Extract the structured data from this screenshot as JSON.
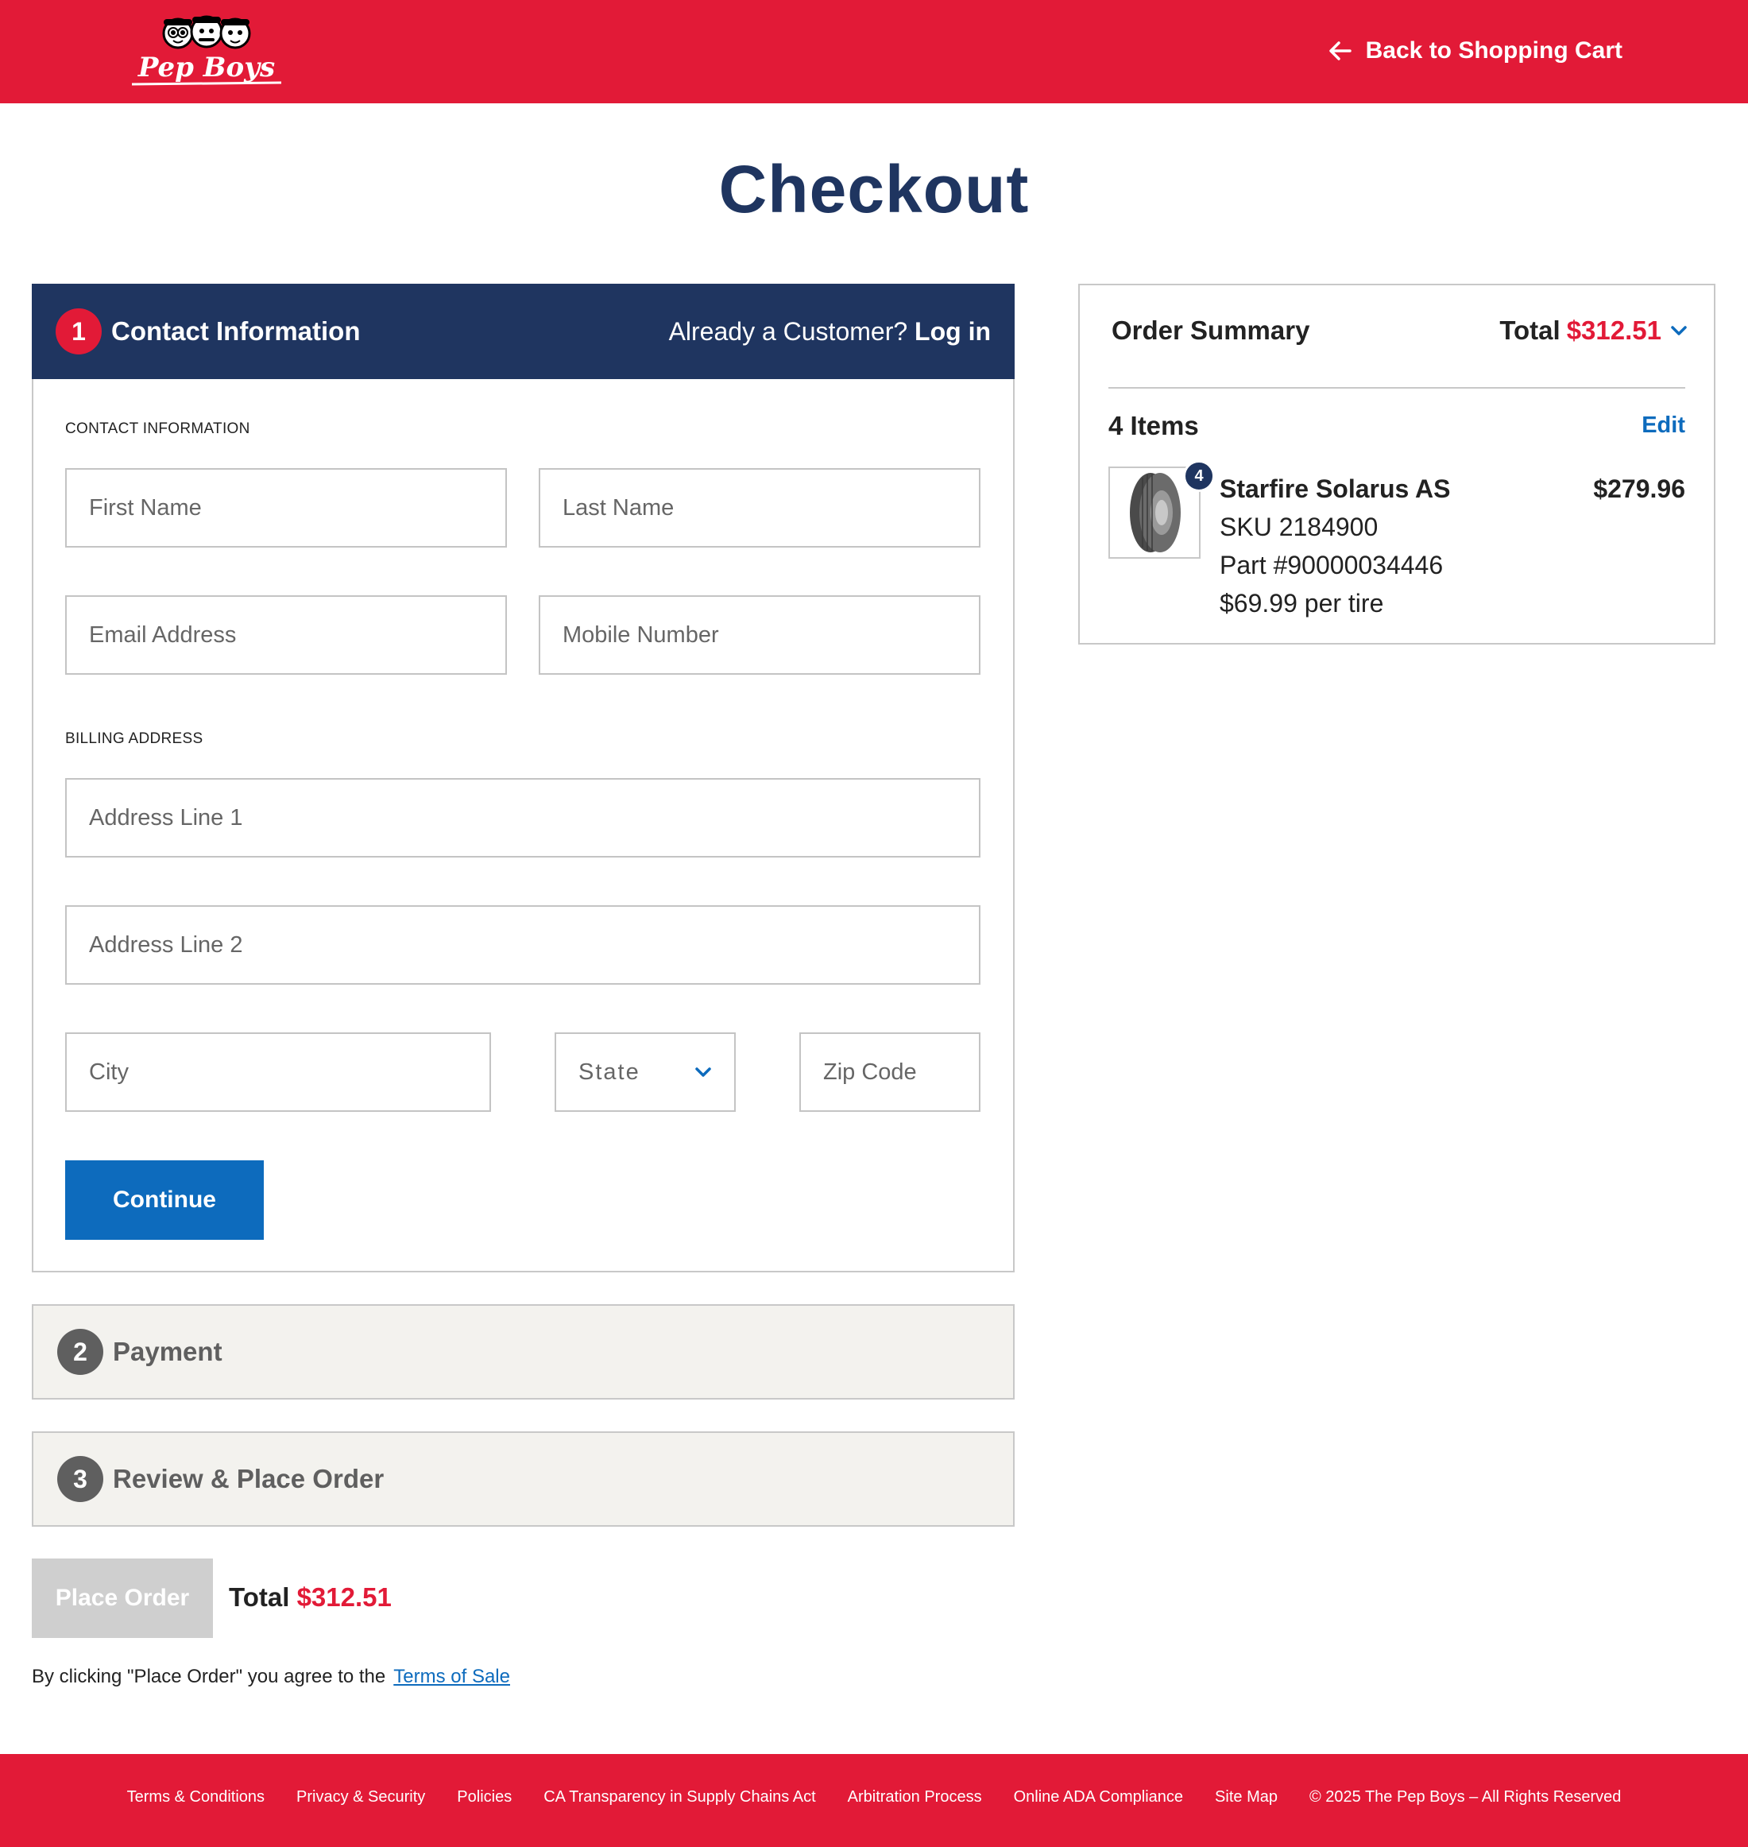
{
  "header": {
    "logo_text": "Pep Boys",
    "back_link": "Back to Shopping Cart"
  },
  "page_title": "Checkout",
  "contact_panel": {
    "step_number": "1",
    "title": "Contact Information",
    "already_customer": "Already a Customer?",
    "login_label": "Log in",
    "contact_section_label": "CONTACT INFORMATION",
    "billing_section_label": "BILLING ADDRESS",
    "fields": {
      "first_name": "First Name",
      "last_name": "Last Name",
      "email": "Email Address",
      "mobile": "Mobile Number",
      "address1": "Address Line 1",
      "address2": "Address Line 2",
      "city": "City",
      "state": "State",
      "zip": "Zip Code"
    },
    "continue_label": "Continue"
  },
  "payment_panel": {
    "step_number": "2",
    "title": "Payment"
  },
  "review_panel": {
    "step_number": "3",
    "title": "Review & Place Order"
  },
  "place_order": {
    "button_label": "Place Order",
    "total_label": "Total",
    "total_value": "$312.51",
    "terms_text": "By clicking \"Place Order\" you agree to the",
    "terms_link": "Terms of Sale"
  },
  "order_summary": {
    "title": "Order Summary",
    "total_label": "Total",
    "total_value": "$312.51",
    "items_count": "4 Items",
    "edit_label": "Edit",
    "item": {
      "quantity": "4",
      "name": "Starfire Solarus AS",
      "sku": "SKU 2184900",
      "part": "Part #90000034446",
      "unit_price": "$69.99 per tire",
      "price": "$279.96"
    }
  },
  "footer": {
    "links": [
      "Terms & Conditions",
      "Privacy & Security",
      "Policies",
      "CA Transparency in Supply Chains Act",
      "Arbitration Process",
      "Online ADA Compliance",
      "Site Map"
    ],
    "copyright": "© 2025 The Pep Boys – All Rights Reserved"
  },
  "colors": {
    "brand_red": "#e21a37",
    "navy": "#1f3560",
    "link_blue": "#0d6bbd"
  }
}
